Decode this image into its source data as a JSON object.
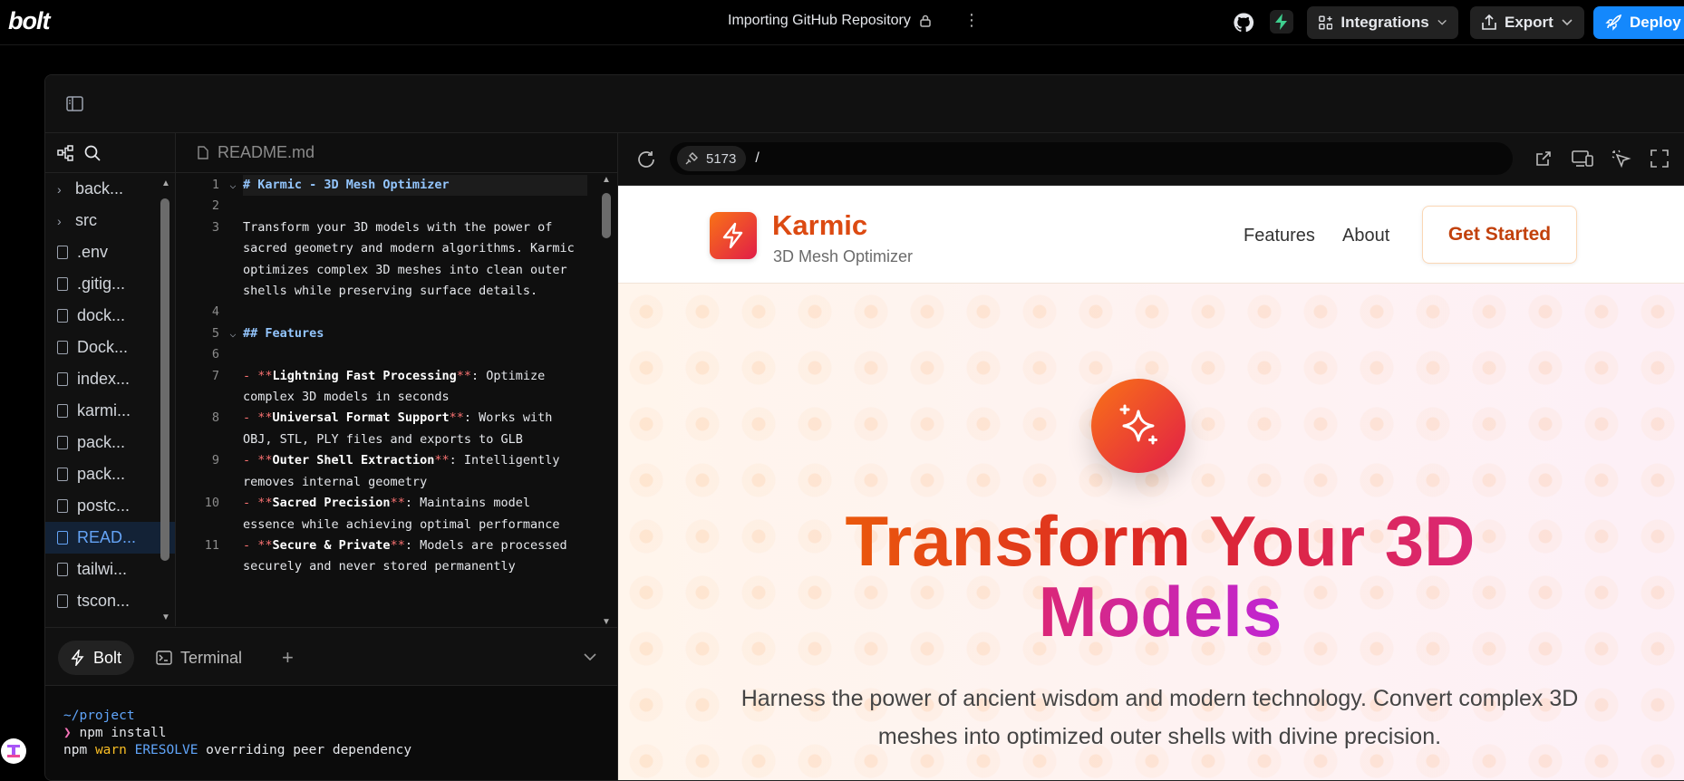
{
  "app": {
    "logo": "bolt",
    "project_title": "Importing GitHub Repository"
  },
  "topbar": {
    "integrations_label": "Integrations",
    "export_label": "Export",
    "deploy_label": "Deploy"
  },
  "filetree": {
    "items": [
      {
        "label": "back...",
        "type": "folder"
      },
      {
        "label": "src",
        "type": "folder"
      },
      {
        "label": ".env",
        "type": "file"
      },
      {
        "label": ".gitig...",
        "type": "file"
      },
      {
        "label": "dock...",
        "type": "file"
      },
      {
        "label": "Dock...",
        "type": "file"
      },
      {
        "label": "index...",
        "type": "file"
      },
      {
        "label": "karmi...",
        "type": "file"
      },
      {
        "label": "pack...",
        "type": "file"
      },
      {
        "label": "pack...",
        "type": "file"
      },
      {
        "label": "postc...",
        "type": "file"
      },
      {
        "label": "READ...",
        "type": "file",
        "active": true
      },
      {
        "label": "tailwi...",
        "type": "file"
      },
      {
        "label": "tscon...",
        "type": "file"
      }
    ]
  },
  "editor": {
    "tab_label": "README.md",
    "lines": {
      "l1": "# Karmic - 3D Mesh Optimizer",
      "l3": "Transform your 3D models with the power of sacred geometry and modern algorithms. Karmic optimizes complex 3D meshes into clean outer shells while preserving surface details.",
      "l5": "## Features",
      "l7_bold": "Lightning Fast Processing",
      "l7_rest": ": Optimize complex 3D models in seconds",
      "l8_bold": "Universal Format Support",
      "l8_rest": ": Works with OBJ, STL, PLY files and exports to GLB",
      "l9_bold": "Outer Shell Extraction",
      "l9_rest": ": Intelligently removes internal geometry",
      "l10_bold": "Sacred Precision",
      "l10_rest": ": Maintains model essence while achieving optimal performance",
      "l11_bold": "Secure & Private",
      "l11_rest": ": Models are processed securely and never stored permanently"
    }
  },
  "bottom_tabs": {
    "bolt_label": "Bolt",
    "terminal_label": "Terminal",
    "add_label": "+"
  },
  "terminal": {
    "path": "~/project",
    "prompt": "❯",
    "command": "npm install",
    "out_npm": "npm",
    "out_warn": "warn",
    "out_code": "ERESOLVE",
    "out_rest": "overriding peer dependency"
  },
  "preview": {
    "port": "5173",
    "path": "/",
    "site": {
      "brand_name": "Karmic",
      "brand_sub": "3D Mesh Optimizer",
      "nav_features": "Features",
      "nav_about": "About",
      "cta": "Get Started",
      "hero_title_1": "Transform Your 3D",
      "hero_title_2": "Models",
      "hero_sub": "Harness the power of ancient wisdom and modern technology. Convert complex 3D meshes into optimized outer shells with divine precision."
    }
  }
}
